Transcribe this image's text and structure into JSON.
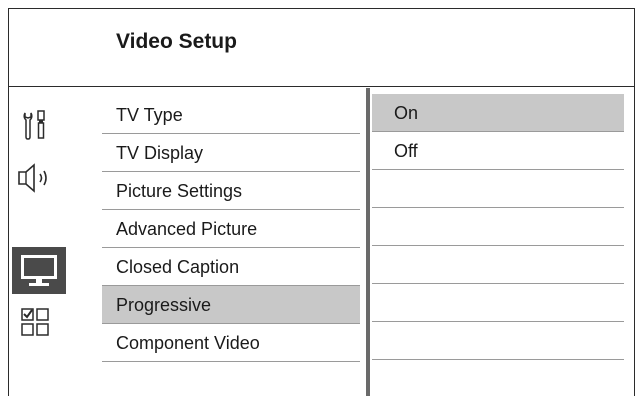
{
  "header": {
    "title": "Video Setup"
  },
  "sidebar": {
    "icons": [
      {
        "name": "general-setup-icon",
        "active": false
      },
      {
        "name": "audio-setup-icon",
        "active": false
      },
      {
        "name": "video-setup-icon",
        "active": true
      },
      {
        "name": "preference-setup-icon",
        "active": false
      }
    ]
  },
  "menu": {
    "items": [
      {
        "label": "TV Type"
      },
      {
        "label": "TV Display"
      },
      {
        "label": "Picture Settings"
      },
      {
        "label": "Advanced Picture"
      },
      {
        "label": "Closed Caption"
      },
      {
        "label": "Progressive",
        "selected": true
      },
      {
        "label": "Component Video"
      }
    ]
  },
  "options": {
    "items": [
      {
        "label": "On",
        "selected": true
      },
      {
        "label": "Off"
      },
      {
        "label": ""
      },
      {
        "label": ""
      },
      {
        "label": ""
      },
      {
        "label": ""
      },
      {
        "label": ""
      }
    ]
  }
}
